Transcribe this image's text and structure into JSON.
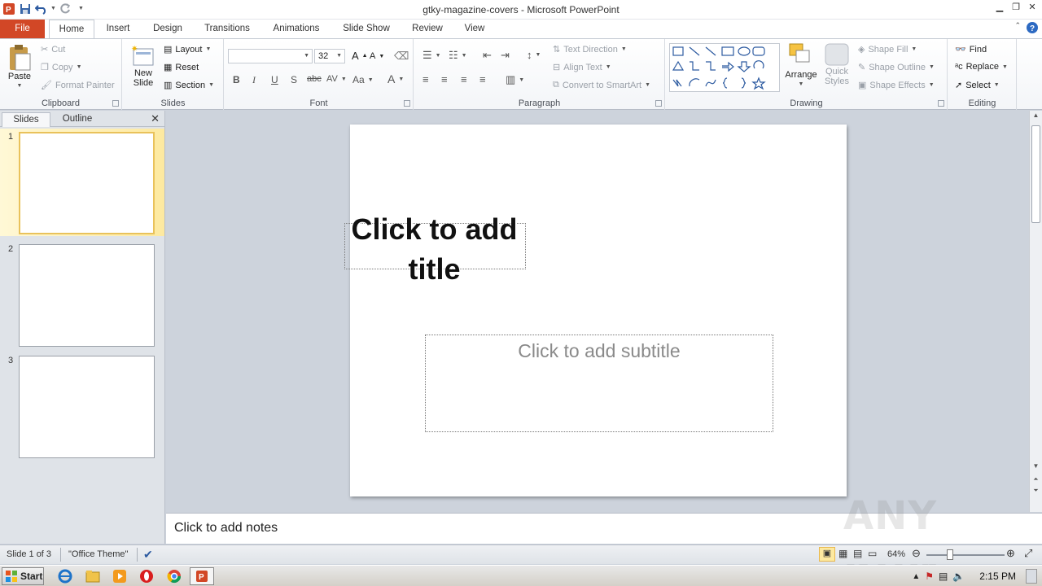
{
  "window": {
    "title": "gtky-magazine-covers  -  Microsoft PowerPoint"
  },
  "tabs": [
    {
      "label": "File"
    },
    {
      "label": "Home"
    },
    {
      "label": "Insert"
    },
    {
      "label": "Design"
    },
    {
      "label": "Transitions"
    },
    {
      "label": "Animations"
    },
    {
      "label": "Slide Show"
    },
    {
      "label": "Review"
    },
    {
      "label": "View"
    }
  ],
  "ribbon": {
    "clipboard": {
      "label": "Clipboard",
      "paste": "Paste",
      "cut": "Cut",
      "copy": "Copy",
      "format_painter": "Format Painter"
    },
    "slides": {
      "label": "Slides",
      "new_slide_1": "New",
      "new_slide_2": "Slide",
      "layout": "Layout",
      "reset": "Reset",
      "section": "Section"
    },
    "font": {
      "label": "Font",
      "font_name": "",
      "font_size": "32"
    },
    "paragraph": {
      "label": "Paragraph",
      "text_direction": "Text Direction",
      "align_text": "Align Text",
      "convert_smartart": "Convert to SmartArt"
    },
    "drawing": {
      "label": "Drawing",
      "arrange": "Arrange",
      "quick_styles_1": "Quick",
      "quick_styles_2": "Styles",
      "shape_fill": "Shape Fill",
      "shape_outline": "Shape Outline",
      "shape_effects": "Shape Effects"
    },
    "editing": {
      "label": "Editing",
      "find": "Find",
      "replace": "Replace",
      "select": "Select"
    }
  },
  "left_panel": {
    "tabs": {
      "slides": "Slides",
      "outline": "Outline"
    },
    "thumbnails": [
      {
        "num": "1"
      },
      {
        "num": "2"
      },
      {
        "num": "3"
      }
    ]
  },
  "slide": {
    "title_placeholder": "Click to add title",
    "subtitle_placeholder": "Click to add subtitle"
  },
  "notes": {
    "placeholder": "Click to add notes"
  },
  "status": {
    "slide_info": "Slide 1 of 3",
    "theme": "\"Office Theme\"",
    "zoom": "64%",
    "zoom_level": 0.64
  },
  "taskbar": {
    "start": "Start",
    "clock": "2:15 PM"
  },
  "watermark": "ANY RUN",
  "colors": {
    "file_tab": "#d24726",
    "selected_thumb": "#e9c25b",
    "workspace": "#cdd3dc"
  }
}
